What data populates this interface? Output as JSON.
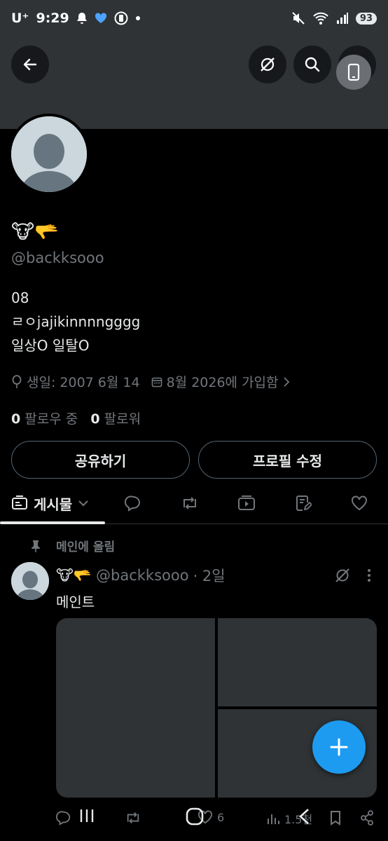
{
  "status_bar": {
    "carrier": "U⁺",
    "time": "9:29",
    "battery": "93"
  },
  "profile": {
    "name": "🐮🫳",
    "handle": "@backksooo",
    "bio_lines": [
      "08",
      "ㄹㅇjajikinnnngggg",
      "일상O 일탈O"
    ],
    "birthday": "생일: 2007 6월 14",
    "joined": "8월 2026에 가입함",
    "following_count": "0",
    "following_label": "팔로우 중",
    "followers_count": "0",
    "followers_label": "팔로워"
  },
  "buttons": {
    "share": "공유하기",
    "edit_profile": "프로필 수정"
  },
  "tabs": {
    "posts_label": "게시물"
  },
  "post": {
    "pinned_label": "메인에 올림",
    "author_name": "🐮🫳",
    "author_handle": "@backksooo",
    "time": "· 2일",
    "text": "메인트",
    "likes": "6",
    "views": "1.5천"
  },
  "colors": {
    "background": "#000000",
    "banner": "#2f3336",
    "accent": "#1d9bf0",
    "muted": "#71767b"
  }
}
